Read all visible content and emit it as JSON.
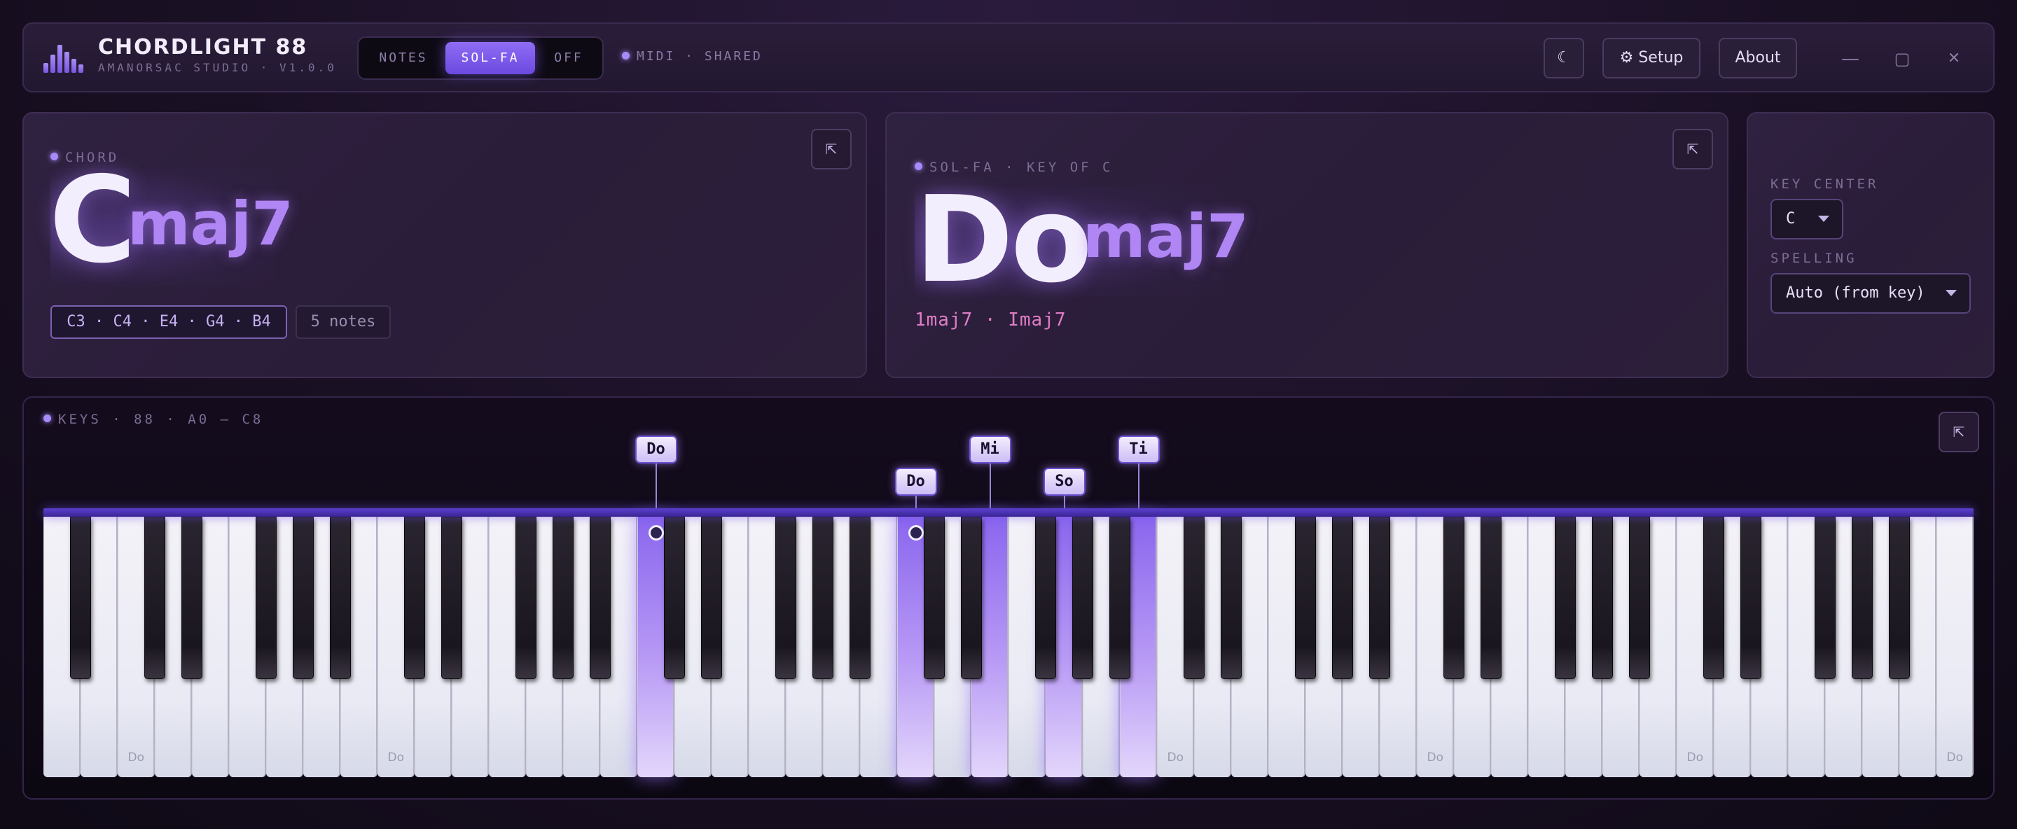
{
  "app": {
    "name": "CHORDLIGHT 88",
    "subtitle": "AMANORSAC STUDIO · V1.0.0",
    "icon": "equalizer-bars-icon"
  },
  "labelMode": {
    "options": [
      "NOTES",
      "SOL-FA",
      "OFF"
    ],
    "selected": "SOL-FA"
  },
  "midi": {
    "status": "MIDI · SHARED"
  },
  "toolbar": {
    "theme_icon": "☾",
    "setup_label": "⚙ Setup",
    "about_label": "About"
  },
  "window": {
    "minimize": "—",
    "maximize": "▢",
    "close": "✕"
  },
  "chord": {
    "label": "CHORD",
    "root": "C",
    "quality": "maj7",
    "notes": "C3 · C4 · E4 · G4 · B4",
    "count": "5 notes",
    "expand_icon": "⇱"
  },
  "solfa": {
    "label": "SOL-FA · KEY OF C",
    "root": "Do",
    "quality": "maj7",
    "roman": "1maj7 · Imaj7",
    "expand_icon": "⇱"
  },
  "settings": {
    "key_center_label": "KEY CENTER",
    "key_center_value": "C",
    "spelling_label": "SPELLING",
    "spelling_value": "Auto (from key)"
  },
  "keyboard": {
    "label": "KEYS · 88 · A0 — C8",
    "expand_icon": "⇱",
    "white_key_count": 52,
    "active_white_keys": [
      16,
      23,
      25,
      27,
      29
    ],
    "pressed_markers": [
      16,
      23
    ],
    "do_label": "Do",
    "do_white_keys": [
      2,
      9,
      30,
      37,
      44,
      51
    ],
    "solfa_tags": [
      {
        "text": "Do",
        "key": 16,
        "row": "upper"
      },
      {
        "text": "Do",
        "key": 23,
        "row": "lower"
      },
      {
        "text": "Mi",
        "key": 25,
        "row": "upper"
      },
      {
        "text": "So",
        "key": 27,
        "row": "lower"
      },
      {
        "text": "Ti",
        "key": 29,
        "row": "upper"
      }
    ]
  },
  "colors": {
    "accent": "#8f6df5",
    "accent_text": "#b085f4",
    "roman": "#e07cc6"
  }
}
